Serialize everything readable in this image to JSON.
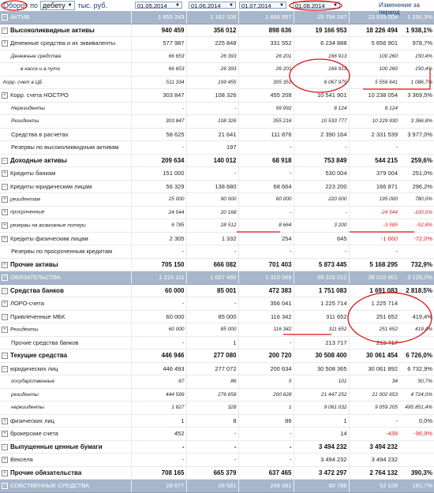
{
  "toolbar": {
    "turnover_label": "Оборот",
    "po_label": "по",
    "selector_value": "дебету",
    "units_label": "тыс. руб.",
    "dates": [
      "01.05.2014",
      "01.06.2014",
      "01.07.2014",
      "01.08.2014"
    ],
    "change_header": "Изменение за период"
  },
  "rows": [
    {
      "style": "sec",
      "exp": "⊟",
      "label": "АКТИВ",
      "v": [
        "1 855 243",
        "1 162 106",
        "1 668 957",
        "25 794 247",
        "23 939 004",
        "1 290,3%"
      ]
    },
    {
      "style": "bold",
      "exp": "⊟",
      "label": "Высоколиквидные активы",
      "v": [
        "940 459",
        "356 012",
        "898 636",
        "19 166 953",
        "18 226 494",
        "1 938,1%"
      ]
    },
    {
      "style": "norm",
      "exp": "⊞",
      "label": "Денежные средства и их эквиваленты",
      "v": [
        "577 987",
        "225 848",
        "331 552",
        "6 234 888",
        "5 656 901",
        "978,7%"
      ]
    },
    {
      "style": "ital",
      "label": "Денежные средства",
      "ind": 14,
      "v": [
        "66 653",
        "26 393",
        "26 201",
        "166 913",
        "100 260",
        "150,4%"
      ]
    },
    {
      "style": "ital",
      "label": "в кассе и в пути",
      "ind": 26,
      "v": [
        "66 653",
        "26 393",
        "26 201",
        "166 913",
        "100 260",
        "150,4%"
      ]
    },
    {
      "style": "ital",
      "label": "Корр. счет в ЦБ",
      "ind": 4,
      "v": [
        "511 334",
        "199 455",
        "305 351",
        "6 067 975",
        "5 556 641",
        "1 086,7%"
      ]
    },
    {
      "style": "norm",
      "exp": "⊞",
      "label": "Корр. счета НОСТРО",
      "v": [
        "303 847",
        "108 326",
        "455 208",
        "10 541 901",
        "10 238 054",
        "3 369,5%"
      ]
    },
    {
      "style": "ital",
      "label": "Нерезиденты",
      "ind": 14,
      "v": [
        "-",
        "-",
        "99 992",
        "8 124",
        "8 124",
        ""
      ]
    },
    {
      "style": "ital",
      "label": "Резиденты",
      "ind": 14,
      "v": [
        "303 847",
        "108 326",
        "355 216",
        "10 533 777",
        "10 229 930",
        "3 366,8%"
      ]
    },
    {
      "style": "norm",
      "label": "Средства в расчетах",
      "ind": 14,
      "v": [
        "58 625",
        "21 641",
        "111 876",
        "2 390 164",
        "2 331 539",
        "3 977,0%"
      ]
    },
    {
      "style": "norm",
      "label": "Резервы по высоколиквидным активам",
      "ind": 14,
      "v": [
        "-",
        "197",
        "-",
        "-",
        "-",
        ""
      ]
    },
    {
      "style": "bold",
      "exp": "⊟",
      "label": "Доходные активы",
      "v": [
        "209 634",
        "140 012",
        "68 918",
        "753 849",
        "544 215",
        "259,6%"
      ]
    },
    {
      "style": "norm",
      "exp": "⊞",
      "label": "Кредиты банкам",
      "v": [
        "151 000",
        "-",
        "-",
        "530 004",
        "379 004",
        "251,0%"
      ]
    },
    {
      "style": "norm",
      "exp": "⊟",
      "label": "Кредиты юридическим лицам",
      "v": [
        "56 329",
        "138 680",
        "68 664",
        "223 200",
        "166 871",
        "296,2%"
      ]
    },
    {
      "style": "ital",
      "exp": "⊞",
      "label": "резидентам",
      "v": [
        "25 000",
        "90 000",
        "60 000",
        "220 000",
        "195 000",
        "780,0%"
      ]
    },
    {
      "style": "ital",
      "exp": "⊞",
      "label": "просроченные",
      "v": [
        "24 544",
        "20 168",
        "-",
        "-",
        "-24 544",
        "-100,0%"
      ],
      "red": [
        4,
        5
      ]
    },
    {
      "style": "ital",
      "exp": "⊞",
      "label": "резервы на возможные потери",
      "v": [
        "6 785",
        "28 512",
        "8 664",
        "3 200",
        "-3 585",
        "-52,8%"
      ],
      "red": [
        4,
        5
      ]
    },
    {
      "style": "norm",
      "exp": "⊞",
      "label": "Кредиты физическим лицам",
      "v": [
        "2 305",
        "1 332",
        "254",
        "645",
        "-1 660",
        "-72,0%"
      ],
      "red": [
        4,
        5
      ]
    },
    {
      "style": "norm",
      "label": "Резервы по просроченным кредитам",
      "ind": 14,
      "v": [
        "-",
        "-",
        "-",
        "-",
        "-",
        ""
      ]
    },
    {
      "style": "bold",
      "exp": "⊞",
      "label": "Прочие активы",
      "v": [
        "705 150",
        "666 082",
        "701 403",
        "5 873 445",
        "5 168 295",
        "732,9%"
      ]
    },
    {
      "style": "sec",
      "exp": "⊟",
      "label": "ОБЯЗАТЕЛЬСТВА",
      "v": [
        "1 215 111",
        "1 027 460",
        "1 310 568",
        "39 226 012",
        "38 010 901",
        "3 128,2%"
      ]
    },
    {
      "style": "bold",
      "exp": "⊟",
      "label": "Средства банков",
      "v": [
        "60 000",
        "85 001",
        "472 383",
        "1 751 083",
        "1 691 083",
        "2 818,5%"
      ]
    },
    {
      "style": "norm",
      "exp": "⊞",
      "label": "ЛОРО-счета",
      "v": [
        "-",
        "-",
        "356 041",
        "1 225 714",
        "1 225 714",
        ""
      ]
    },
    {
      "style": "norm",
      "exp": "⊟",
      "label": "Привлеченные МБК",
      "v": [
        "60 000",
        "85 000",
        "116 342",
        "311 652",
        "251 652",
        "419,4%"
      ]
    },
    {
      "style": "ital",
      "exp": "⊞",
      "label": "Резиденты",
      "v": [
        "60 000",
        "85 000",
        "116 342",
        "311 652",
        "251 652",
        "419,4%"
      ]
    },
    {
      "style": "norm",
      "label": "Прочие средства банков",
      "ind": 14,
      "v": [
        "-",
        "1",
        "-",
        "213 717",
        "213 717",
        ""
      ]
    },
    {
      "style": "bold",
      "exp": "⊟",
      "label": "Текущие средства",
      "v": [
        "446 946",
        "277 080",
        "200 720",
        "30 508 400",
        "30 061 454",
        "6 726,0%"
      ]
    },
    {
      "style": "norm",
      "exp": "⊟",
      "label": "юридических лиц",
      "v": [
        "446 493",
        "277 072",
        "200 634",
        "30 508 365",
        "30 061 892",
        "6 732,9%"
      ]
    },
    {
      "style": "ital",
      "label": "государственные",
      "ind": 14,
      "v": [
        "67",
        "86",
        "5",
        "101",
        "34",
        "50,7%"
      ]
    },
    {
      "style": "ital",
      "label": "резиденты",
      "ind": 14,
      "v": [
        "444 599",
        "276 658",
        "200 628",
        "21 447 252",
        "21 002 653",
        "4 724,0%"
      ]
    },
    {
      "style": "ital",
      "label": "нерезиденты",
      "ind": 14,
      "v": [
        "1 827",
        "328",
        "1",
        "9 061 032",
        "9 059 205",
        "495 851,4%"
      ]
    },
    {
      "style": "norm",
      "exp": "⊞",
      "label": "физических лиц",
      "v": [
        "1",
        "8",
        "86",
        "1",
        "-",
        "0,0%"
      ]
    },
    {
      "style": "norm",
      "exp": "⊞",
      "label": "брокерские счета",
      "v": [
        "452",
        "-",
        "-",
        "14",
        "-438",
        "-96,9%"
      ],
      "red": [
        4,
        5
      ]
    },
    {
      "style": "bold",
      "exp": "⊟",
      "label": "Выпущенные ценные бумаги",
      "v": [
        "-",
        "-",
        "-",
        "3 494 232",
        "3 494 232",
        ""
      ]
    },
    {
      "style": "norm",
      "exp": "⊞",
      "label": "Векселя",
      "v": [
        "-",
        "-",
        "-",
        "3 494 232",
        "3 494 232",
        ""
      ]
    },
    {
      "style": "bold",
      "exp": "⊞",
      "label": "Прочие обязательства",
      "v": [
        "708 165",
        "665 379",
        "637 465",
        "3 472 297",
        "2 764 132",
        "390,3%"
      ]
    },
    {
      "style": "sec",
      "exp": "⊟",
      "label": "СОБСТВЕННЫЕ СРЕДСТВА",
      "v": [
        "28 677",
        "28 581",
        "246 391",
        "80 786",
        "52 109",
        "181,7%"
      ]
    }
  ]
}
